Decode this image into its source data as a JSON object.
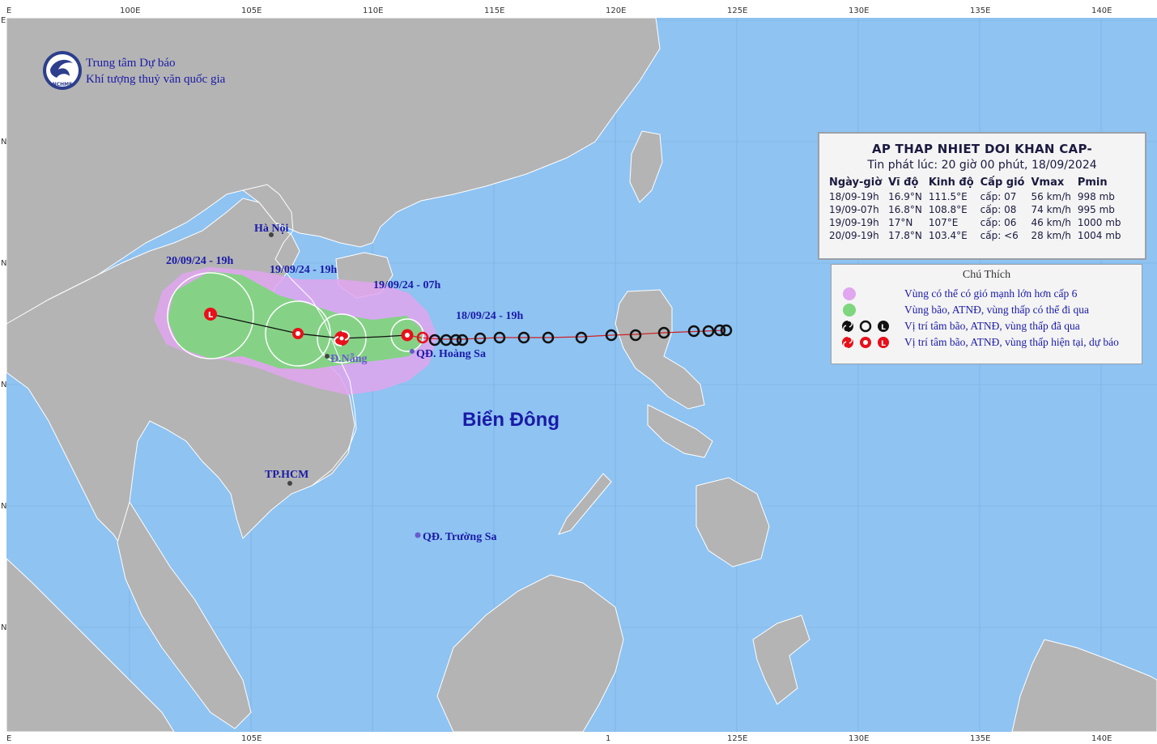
{
  "org": {
    "line1": "Trung tâm Dự báo",
    "line2": "Khí tượng thuỷ văn quốc gia",
    "logo_text": "NCHMF"
  },
  "axes": {
    "top_labels": [
      "E",
      "100E",
      "105E",
      "110E",
      "115E",
      "120E",
      "125E",
      "130E",
      "135E",
      "140E"
    ],
    "bottom_labels": [
      "E",
      "105E",
      "1",
      "125E",
      "130E",
      "135E",
      "140E"
    ],
    "left_marks": [
      "E",
      "N",
      "N",
      "N",
      "N",
      "N"
    ]
  },
  "places": {
    "hanoi": "Hà Nội",
    "danang": "Đ.Nẵng",
    "hoangsa": "QĐ. Hoàng Sa",
    "hcm": "TP.HCM",
    "truongsa": "QĐ. Trường Sa",
    "sea": "Biển Đông"
  },
  "forecast_labels": {
    "t1": "20/09/24 - 19h",
    "t2": "19/09/24 - 19h",
    "t3": "19/09/24 - 07h",
    "t4": "18/09/24 - 19h"
  },
  "info": {
    "title": "AP THAP NHIET DOI KHAN CAP-",
    "issued": "Tin phát lúc: 20 giờ 00 phút, 18/09/2024",
    "headers": [
      "Ngày-giờ",
      "Vĩ độ",
      "Kinh độ",
      "Cấp gió",
      "Vmax",
      "Pmin"
    ],
    "rows": [
      [
        "18/09-19h",
        "16.9°N",
        "111.5°E",
        "cấp: 07",
        "56 km/h",
        "998 mb"
      ],
      [
        "19/09-07h",
        "16.8°N",
        "108.8°E",
        "cấp: 08",
        "74 km/h",
        "995 mb"
      ],
      [
        "19/09-19h",
        "17°N",
        "107°E",
        "cấp: 06",
        "46 km/h",
        "1000 mb"
      ],
      [
        "20/09-19h",
        "17.8°N",
        "103.4°E",
        "cấp: <6",
        "28 km/h",
        "1004 mb"
      ]
    ]
  },
  "legend": {
    "title": "Chú Thích",
    "items": [
      "Vùng có thể có gió mạnh lớn hơn cấp 6",
      "Vùng bão, ATNĐ, vùng thấp có thể đi qua",
      "Vị trí tâm bão, ATNĐ, vùng thấp đã qua",
      "Vị trí tâm bão, ATNĐ, vùng thấp hiện tại, dự báo"
    ]
  },
  "colors": {
    "ocean": "#8ec3f2",
    "land": "#b4b4b4",
    "strong_wind_zone": "#e0a6ef",
    "storm_path_zone": "#7ed67e",
    "past_track": "#111111",
    "current_forecast": "#e8101a",
    "label_blue": "#1a1aa8"
  },
  "icons": [
    "storm-past-icon",
    "depression-past-icon",
    "low-past-icon",
    "storm-forecast-icon",
    "depression-forecast-icon",
    "low-forecast-icon"
  ]
}
